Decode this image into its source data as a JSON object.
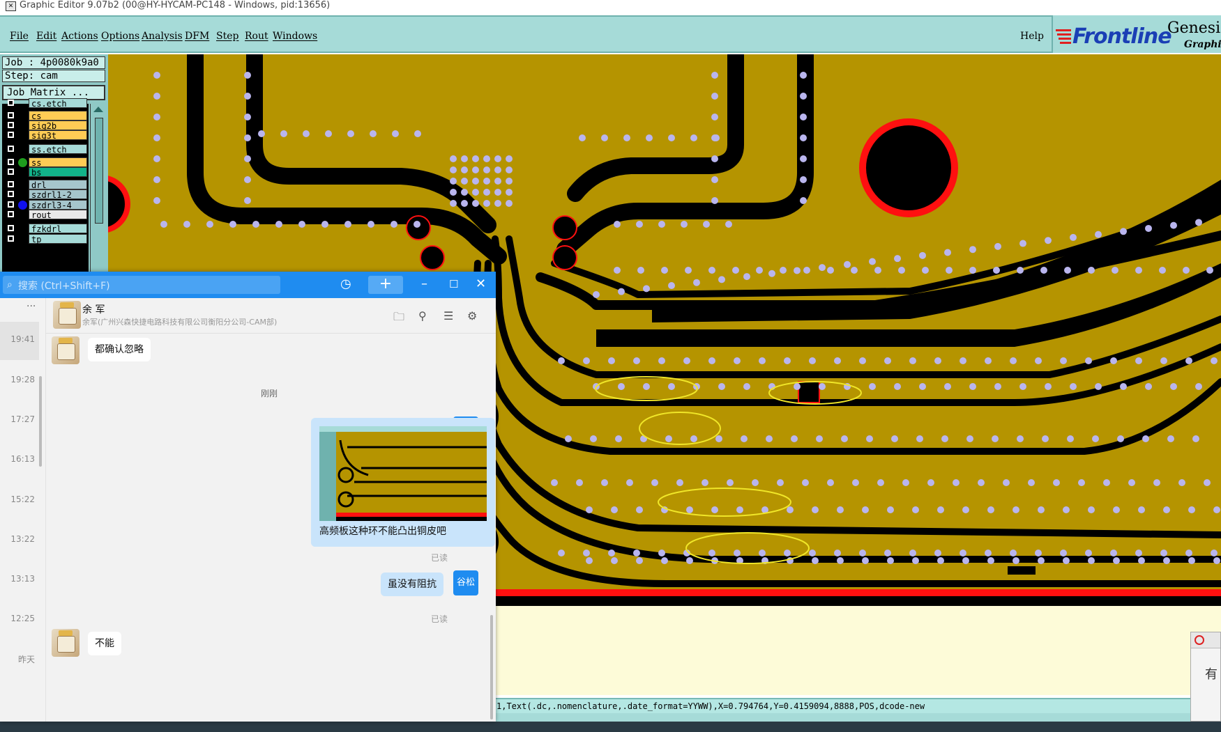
{
  "window": {
    "title": "Graphic Editor 9.07b2 (00@HY-HYCAM-PC148 - Windows, pid:13656)"
  },
  "menu": {
    "items": [
      "File",
      "Edit",
      "Actions",
      "Options",
      "Analysis",
      "DFM",
      "Step",
      "Rout",
      "Windows"
    ],
    "help": "Help"
  },
  "brand": {
    "name": "Frontline",
    "product": "Genesis",
    "subtitle": "Graphic"
  },
  "job": {
    "job_label": "Job : 4p0080k9a0",
    "step_label": "Step: cam",
    "matrix_button": "Job Matrix ..."
  },
  "layers": [
    {
      "name": "cs.etch",
      "color": "#a6dbd8"
    },
    {
      "name": "cs",
      "color": "#ffcc55"
    },
    {
      "name": "sig2b",
      "color": "#ffcc55"
    },
    {
      "name": "sig3t",
      "color": "#ffcc55"
    },
    {
      "name": "ss.etch",
      "color": "#a6dbd8"
    },
    {
      "name": "ss",
      "color": "#ffcc55",
      "active": "#1e9e1e"
    },
    {
      "name": "bs",
      "color": "#12b38a"
    },
    {
      "name": "drl",
      "color": "#a6c6cc"
    },
    {
      "name": "szdrl1-2",
      "color": "#a6c6cc"
    },
    {
      "name": "szdrl3-4",
      "color": "#a6c6cc",
      "active": "#1010ee"
    },
    {
      "name": "rout",
      "color": "#e8e8e8"
    },
    {
      "name": "fzkdrl",
      "color": "#a6dbd8"
    },
    {
      "name": "tp",
      "color": "#a6dbd8"
    }
  ],
  "command_line": "1,Text(.dc,.nomenclature,.date_format=YYWW),X=0.794764,Y=0.4159094,8888,POS,dcode-new",
  "chat": {
    "search_placeholder": "搜索 (Ctrl+Shift+F)",
    "more": "···",
    "times": [
      "19:41",
      "19:28",
      "17:27",
      "16:13",
      "15:22",
      "13:22",
      "13:13",
      "12:25",
      "昨天"
    ],
    "contact": {
      "name": "余 军",
      "org": "余军(广州兴森快捷电路科技有限公司衡阳分公司-CAM部)"
    },
    "messages": {
      "m1": "都确认忽略",
      "divider": "刚刚",
      "me_name": "谷松",
      "m2_caption": "高频板这种环不能凸出铜皮吧",
      "m2_read": "已读",
      "m3": "虽没有阻抗",
      "m3_read": "已读",
      "m4": "不能"
    }
  },
  "popup": {
    "text": "有"
  },
  "colors": {
    "copper": "#b59400",
    "dielectric": "#000000",
    "via": "#b9b5ee",
    "highlight": "#f0e628",
    "mask": "#ff1010"
  }
}
